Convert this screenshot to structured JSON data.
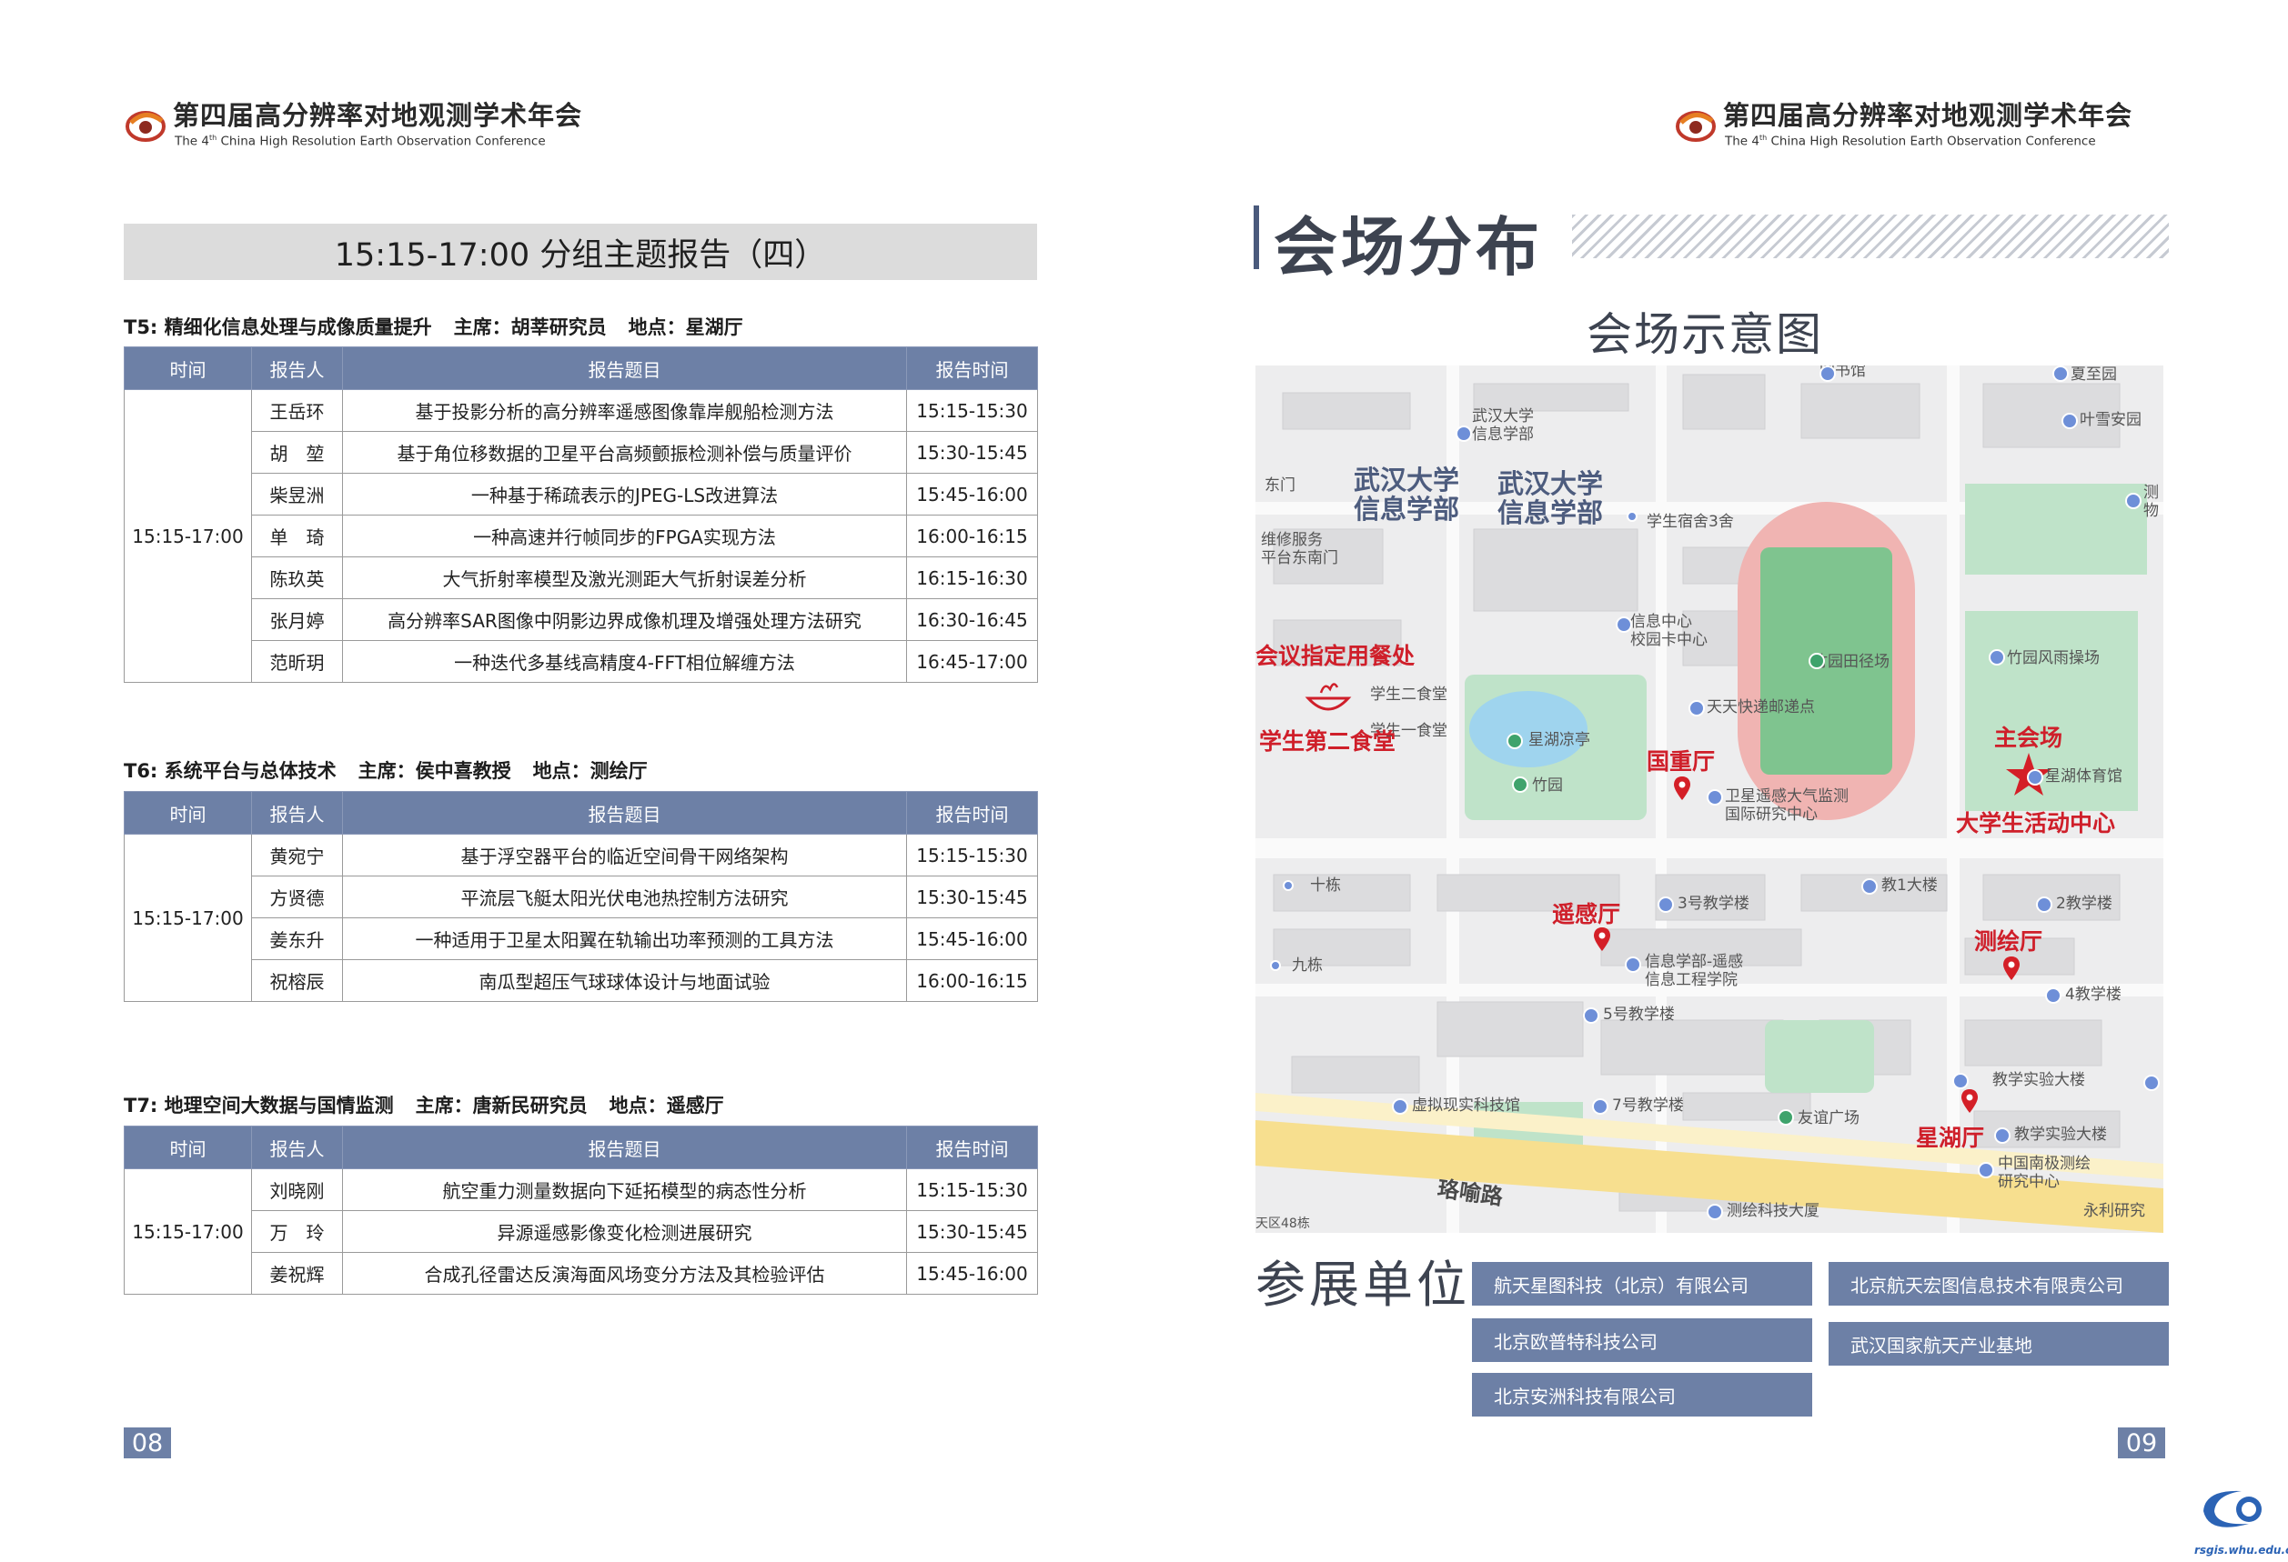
{
  "header": {
    "title_zh": "第四届高分辨率对地观测学术年会",
    "title_en_pre": "The 4",
    "title_en_sup": "th",
    "title_en_post": " China High Resolution Earth Observation Conference"
  },
  "left": {
    "session_title": "15:15-17:00 分组主题报告（四）",
    "columns": [
      "时间",
      "报告人",
      "报告题目",
      "报告时间"
    ],
    "tracks": [
      {
        "name": "T5: 精细化信息处理与成像质量提升",
        "chair": "主席：胡莘研究员",
        "venue": "地点：星湖厅",
        "time": "15:15-17:00",
        "rows": [
          {
            "speaker": "王岳环",
            "topic": "基于投影分析的高分辨率遥感图像靠岸舰船检测方法",
            "slot": "15:15-15:30"
          },
          {
            "speaker": "胡　堃",
            "topic": "基于角位移数据的卫星平台高频颤振检测补偿与质量评价",
            "slot": "15:30-15:45"
          },
          {
            "speaker": "柴昱洲",
            "topic": "一种基于稀疏表示的JPEG-LS改进算法",
            "slot": "15:45-16:00"
          },
          {
            "speaker": "单　琦",
            "topic": "一种高速并行帧同步的FPGA实现方法",
            "slot": "16:00-16:15"
          },
          {
            "speaker": "陈玖英",
            "topic": "大气折射率模型及激光测距大气折射误差分析",
            "slot": "16:15-16:30"
          },
          {
            "speaker": "张月婷",
            "topic": "高分辨率SAR图像中阴影边界成像机理及增强处理方法研究",
            "slot": "16:30-16:45"
          },
          {
            "speaker": "范昕玥",
            "topic": "一种迭代多基线高精度4-FFT相位解缠方法",
            "slot": "16:45-17:00"
          }
        ]
      },
      {
        "name": "T6: 系统平台与总体技术",
        "chair": "主席：侯中喜教授",
        "venue": "地点：测绘厅",
        "time": "15:15-17:00",
        "rows": [
          {
            "speaker": "黄宛宁",
            "topic": "基于浮空器平台的临近空间骨干网络架构",
            "slot": "15:15-15:30"
          },
          {
            "speaker": "方贤德",
            "topic": "平流层飞艇太阳光伏电池热控制方法研究",
            "slot": "15:30-15:45"
          },
          {
            "speaker": "姜东升",
            "topic": "一种适用于卫星太阳翼在轨输出功率预测的工具方法",
            "slot": "15:45-16:00"
          },
          {
            "speaker": "祝榕辰",
            "topic": "南瓜型超压气球球体设计与地面试验",
            "slot": "16:00-16:15"
          }
        ]
      },
      {
        "name": "T7: 地理空间大数据与国情监测",
        "chair": "主席：唐新民研究员",
        "venue": "地点：遥感厅",
        "time": "15:15-17:00",
        "rows": [
          {
            "speaker": "刘晓刚",
            "topic": "航空重力测量数据向下延拓模型的病态性分析",
            "slot": "15:15-15:30"
          },
          {
            "speaker": "万　玲",
            "topic": "异源遥感影像变化检测进展研究",
            "slot": "15:30-15:45"
          },
          {
            "speaker": "姜祝辉",
            "topic": "合成孔径雷达反演海面风场变分方法及其检验评估",
            "slot": "15:45-16:00"
          }
        ]
      }
    ],
    "page_number": "08"
  },
  "right": {
    "section_title": "会场分布",
    "map_title": "会场示意图",
    "map": {
      "big_labels": [
        "武汉大学\n信息学部",
        "武汉大学\n信息学部"
      ],
      "red_labels": {
        "dining": "会议指定用餐处",
        "canteen": "学生第二食堂",
        "main_venue": "主会场",
        "activity_center": "大学生活动中心",
        "guozhong": "国重厅",
        "yaogan": "遥感厅",
        "cehui": "测绘厅",
        "xinghu": "星湖厅"
      },
      "labels": {
        "library": "图书馆",
        "xiapian": "夏至园",
        "whu_info": "武汉大学\n信息学部",
        "yefeng": "叶雪安园",
        "east_gate": "东门",
        "service": "维修服务\n平台东南门",
        "dorm": "学生宿舍3舍",
        "info_center": "信息中心\n校园卡中心",
        "track_field": "竹园田径场",
        "rain_field": "竹园风雨操场",
        "canteen2": "学生二食堂",
        "canteen1": "学生一食堂",
        "express": "天天快递邮递点",
        "pavilion": "星湖凉亭",
        "bamboo": "竹园",
        "stadium": "星湖体育馆",
        "satellite": "卫星遥感大气监测\n国际研究中心",
        "ten": "十栋",
        "nine": "九栋",
        "bldg3": "3号教学楼",
        "bldg_jiao1": "教1大楼",
        "bldg2": "2教学楼",
        "info_school": "信息学部-遥感\n信息工程学院",
        "bldg4": "4教学楼",
        "bldg5": "5号教学楼",
        "lab_bldg": "教学实验大楼",
        "vr": "虚拟现实科技馆",
        "bldg7": "7号教学楼",
        "plaza": "友谊广场",
        "lab_bldg2": "教学实验大楼",
        "polar": "中国南极测绘\n研究中心",
        "road": "珞喻路",
        "survey_tech": "测绘科技大厦",
        "yongli": "永利研究",
        "test": "测\n物",
        "plaza_rt": "天区48栋"
      }
    },
    "exhibitors_title": "参展单位",
    "exhibitors": [
      "航天星图科技（北京）有限公司",
      "北京航天宏图信息技术有限责公司",
      "北京欧普特科技公司",
      "武汉国家航天产业基地",
      "北京安洲科技有限公司"
    ],
    "page_number": "09",
    "corner_site": "rsgis.whu.edu.cn"
  }
}
